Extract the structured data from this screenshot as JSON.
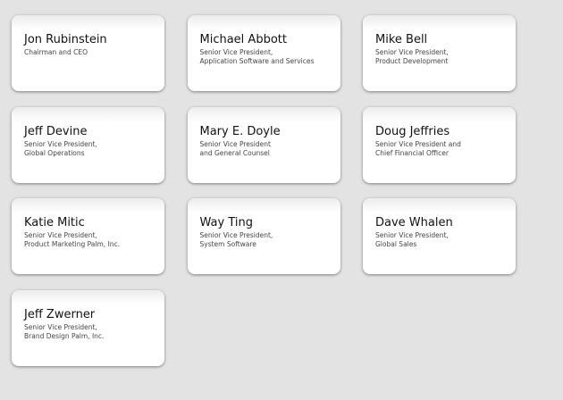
{
  "people": [
    {
      "name": "Jon Rubinstein",
      "title": "Chairman and CEO"
    },
    {
      "name": "Michael Abbott",
      "title": "Senior Vice President,\nApplication Software and Services"
    },
    {
      "name": "Mike Bell",
      "title": "Senior Vice President,\nProduct Development"
    },
    {
      "name": "Jeff Devine",
      "title": "Senior Vice President,\nGlobal Operations"
    },
    {
      "name": "Mary E. Doyle",
      "title": "Senior Vice President\nand General Counsel"
    },
    {
      "name": "Doug Jeffries",
      "title": "Senior Vice President and\nChief Financial Officer"
    },
    {
      "name": "Katie Mitic",
      "title": "Senior Vice President,\nProduct Marketing Palm, Inc."
    },
    {
      "name": "Way Ting",
      "title": "Senior Vice President,\nSystem Software"
    },
    {
      "name": "Dave Whalen",
      "title": "Senior Vice President,\nGlobal Sales"
    },
    {
      "name": "Jeff Zwerner",
      "title": "Senior Vice President,\nBrand Design Palm, Inc."
    }
  ]
}
